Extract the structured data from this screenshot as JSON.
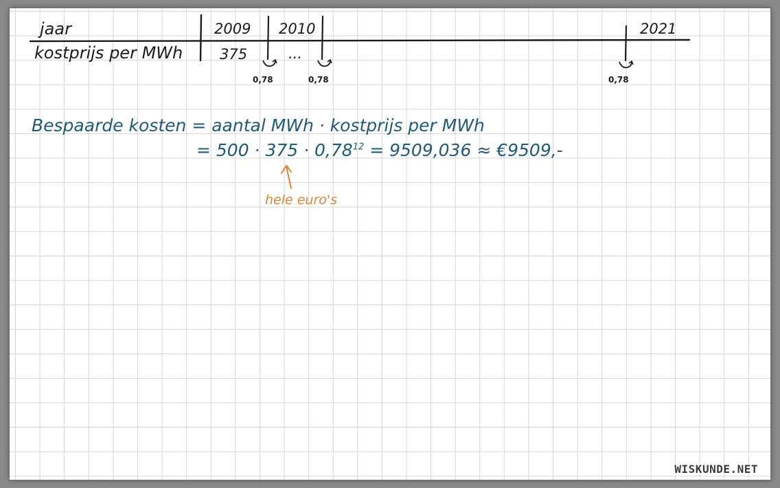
{
  "table": {
    "row1_label": "jaar",
    "row2_label": "kostprijs per MWh",
    "years": {
      "y2009": "2009",
      "y2010": "2010",
      "y2021": "2021"
    },
    "value_2009": "375",
    "ellipsis": "...",
    "factors": [
      "0,78",
      "0,78",
      "0,78"
    ]
  },
  "formula": {
    "line1": "Bespaarde kosten = aantal MWh · kostprijs per MWh",
    "line2_main": "= 500 · 375 · 0,78",
    "line2_exponent": "12",
    "line2_rest": "= 9509,036 ≈ €9509,-"
  },
  "annotation": {
    "text": "hele euro's"
  },
  "colors": {
    "ink": "#1b1b1b",
    "blue": "#1f5a78",
    "orange": "#e58236",
    "grid": "#d6d6d6"
  },
  "watermark": "WISKUNDE.NET"
}
